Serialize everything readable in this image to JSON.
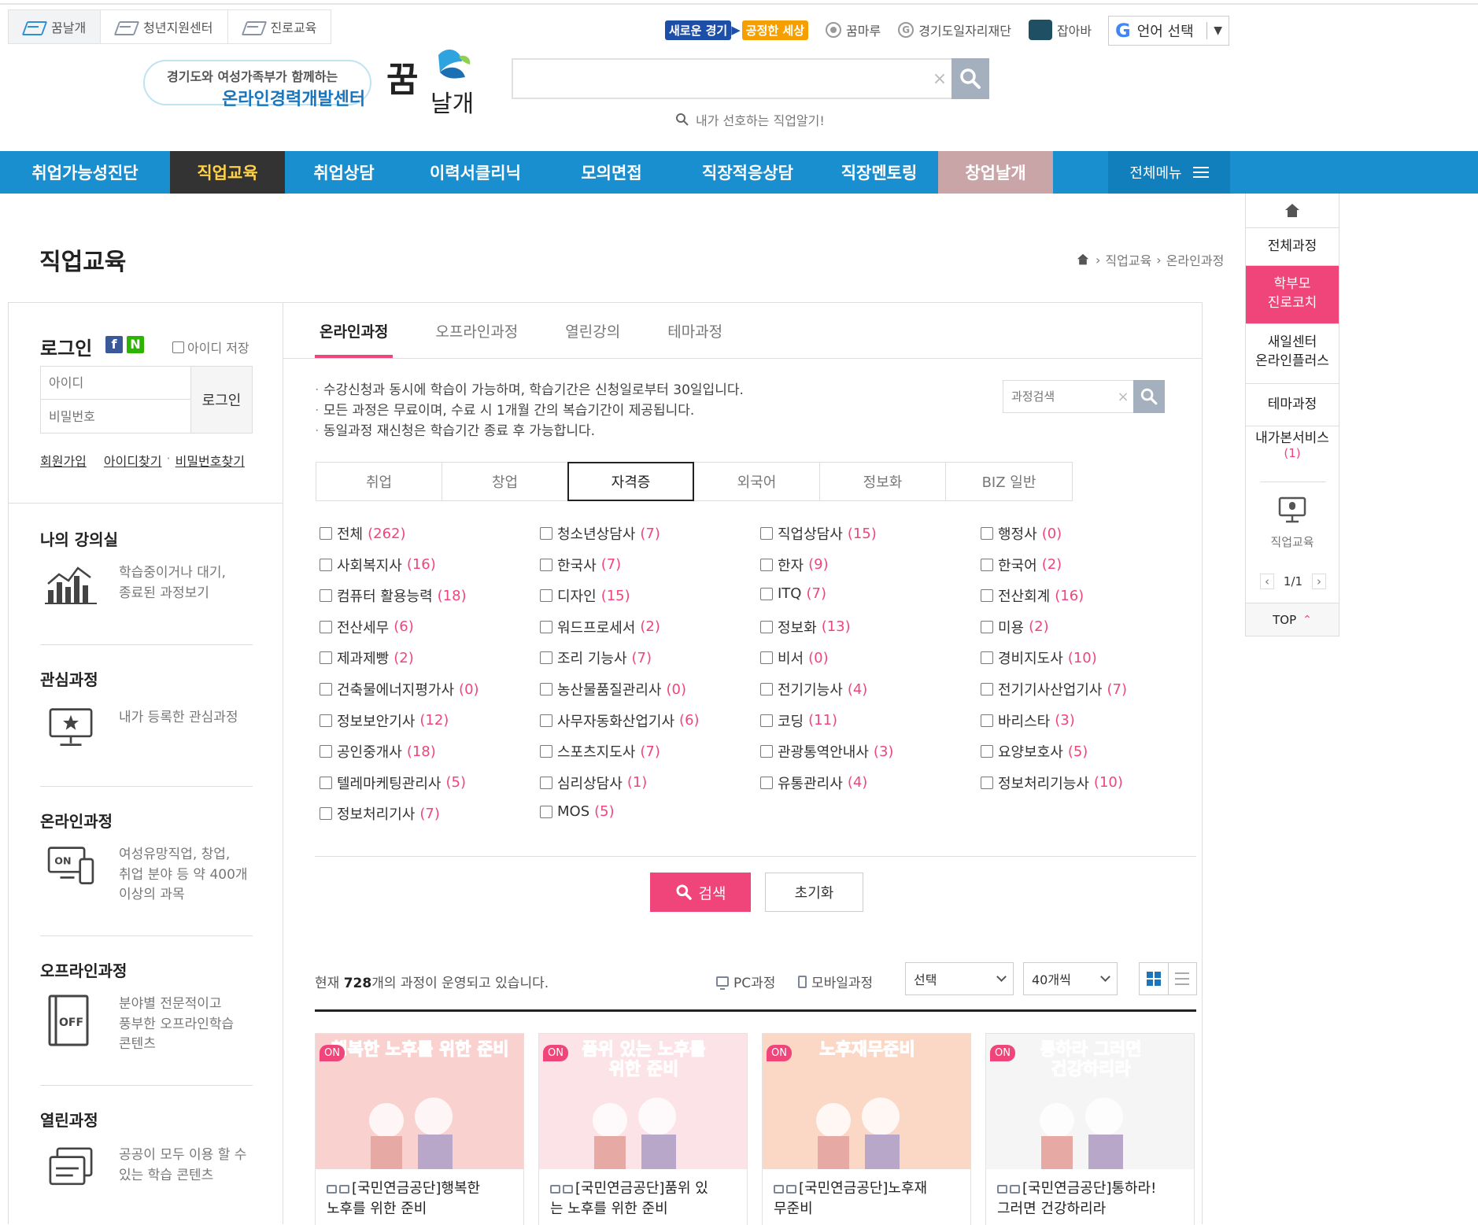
{
  "util_tabs": [
    "꿈날개",
    "청년지원센터",
    "진로교육"
  ],
  "partners": {
    "badge_1": "새로운 경기",
    "badge_2": "공정한 세상",
    "items": [
      "꿈마루",
      "경기도일자리재단",
      "잡아바"
    ]
  },
  "language": {
    "label": "언어 선택"
  },
  "logo": {
    "line1": "경기도와 여성가족부가 함께하는",
    "line2": "온라인경력개발센터",
    "mark_1": "꿈",
    "mark_2": "날개"
  },
  "search": {
    "placeholder": "",
    "hint": "내가 선호하는 직업알기!"
  },
  "gnb": {
    "items": [
      "취업가능성진단",
      "직업교육",
      "취업상담",
      "이력서클리닉",
      "모의면접",
      "직장적응상담",
      "직장멘토링",
      "창업날개"
    ],
    "all_menu": "전체메뉴"
  },
  "quick": {
    "all_courses": "전체과정",
    "parent_coach_1": "학부모",
    "parent_coach_2": "진로코치",
    "saeil_1": "새일센터",
    "saeil_2": "온라인플러스",
    "theme": "테마과정",
    "my_service": "내가본서비스",
    "my_service_count": "(1)",
    "recent_label": "직업교육",
    "pager": "1/1",
    "top": "TOP"
  },
  "page": {
    "title": "직업교육",
    "breadcrumb": [
      "직업교육",
      "온라인과정"
    ]
  },
  "login": {
    "title": "로그인",
    "facebook": "f",
    "naver": "N",
    "save_id": "아이디 저장",
    "id_placeholder": "아이디",
    "pw_placeholder": "비밀번호",
    "button": "로그인",
    "join": "회원가입",
    "find_id": "아이디찾기",
    "dot": "·",
    "find_pw": "비밀번호찾기"
  },
  "side": [
    {
      "title": "나의 강의실",
      "desc_1": "학습중이거나 대기,",
      "desc_2": "종료된 과정보기",
      "desc_3": ""
    },
    {
      "title": "관심과정",
      "desc_1": "내가 등록한 관심과정",
      "desc_2": "",
      "desc_3": ""
    },
    {
      "title": "온라인과정",
      "desc_1": "여성유망직업, 창업,",
      "desc_2": "취업 분야 등 약 400개",
      "desc_3": "이상의 과목"
    },
    {
      "title": "오프라인과정",
      "desc_1": "분야별 전문적이고",
      "desc_2": "풍부한 오프라인학습",
      "desc_3": "콘텐츠"
    },
    {
      "title": "열린과정",
      "desc_1": "공공이 모두 이용 할 수",
      "desc_2": "있는 학습 콘텐츠",
      "desc_3": ""
    }
  ],
  "side_icons": {
    "on": "ON",
    "off": "OFF"
  },
  "tabs": [
    "온라인과정",
    "오프라인과정",
    "열린강의",
    "테마과정"
  ],
  "notice": [
    "수강신청과 동시에 학습이 가능하며, 학습기간은 신청일로부터 30일입니다.",
    "모든 과정은 무료이며, 수료 시 1개월 간의 복습기간이 제공됩니다.",
    "동일과정 재신청은 학습기간 종료 후 가능합니다."
  ],
  "course_search": {
    "placeholder": "과정검색"
  },
  "categories": [
    "취업",
    "창업",
    "자격증",
    "외국어",
    "정보화",
    "BIZ 일반"
  ],
  "checkboxes": [
    [
      "전체",
      "(262)"
    ],
    [
      "청소년상담사",
      "(7)"
    ],
    [
      "직업상담사",
      "(15)"
    ],
    [
      "행정사",
      "(0)"
    ],
    [
      "사회복지사",
      "(16)"
    ],
    [
      "한국사",
      "(7)"
    ],
    [
      "한자",
      "(9)"
    ],
    [
      "한국어",
      "(2)"
    ],
    [
      "컴퓨터 활용능력",
      "(18)"
    ],
    [
      "디자인",
      "(15)"
    ],
    [
      "ITQ",
      "(7)"
    ],
    [
      "전산회계",
      "(16)"
    ],
    [
      "전산세무",
      "(6)"
    ],
    [
      "워드프로세서",
      "(2)"
    ],
    [
      "정보화",
      "(13)"
    ],
    [
      "미용",
      "(2)"
    ],
    [
      "제과제빵",
      "(2)"
    ],
    [
      "조리 기능사",
      "(7)"
    ],
    [
      "비서",
      "(0)"
    ],
    [
      "경비지도사",
      "(10)"
    ],
    [
      "건축물에너지평가사",
      "(0)"
    ],
    [
      "농산물품질관리사",
      "(0)"
    ],
    [
      "전기기능사",
      "(4)"
    ],
    [
      "전기기사산업기사",
      "(7)"
    ],
    [
      "정보보안기사",
      "(12)"
    ],
    [
      "사무자동화산업기사",
      "(6)"
    ],
    [
      "코딩",
      "(11)"
    ],
    [
      "바리스타",
      "(3)"
    ],
    [
      "공인중개사",
      "(18)"
    ],
    [
      "스포츠지도사",
      "(7)"
    ],
    [
      "관광통역안내사",
      "(3)"
    ],
    [
      "요양보호사",
      "(5)"
    ],
    [
      "텔레마케팅관리사",
      "(5)"
    ],
    [
      "심리상담사",
      "(1)"
    ],
    [
      "유통관리사",
      "(4)"
    ],
    [
      "정보처리기능사",
      "(10)"
    ],
    [
      "정보처리기사",
      "(7)"
    ],
    [
      "MOS",
      "(5)"
    ]
  ],
  "buttons": {
    "search": "검색",
    "reset": "초기화"
  },
  "list": {
    "count_prefix": "현재",
    "count": "728",
    "count_suffix": "개의 과정이 운영되고 있습니다.",
    "pc": "PC과정",
    "mobile": "모바일과정",
    "select": "선택",
    "per_page": "40개씩"
  },
  "courses": [
    {
      "badge": "ON",
      "thumb_title_1": "행복한 노후를 위한 준비",
      "thumb_title_2": "",
      "name_1": "[국민연금공단]행복한",
      "name_2": "노후를 위한 준비",
      "bg": "#f9d2cf"
    },
    {
      "badge": "ON",
      "thumb_title_1": "품위 있는 노후를",
      "thumb_title_2": "위한 준비",
      "name_1": "[국민연금공단]품위 있",
      "name_2": "는 노후를 위한 준비",
      "bg": "#fbe3e8"
    },
    {
      "badge": "ON",
      "thumb_title_1": "노후재무준비",
      "thumb_title_2": "",
      "name_1": "[국민연금공단]노후재",
      "name_2": "무준비",
      "bg": "#fbd8c6"
    },
    {
      "badge": "ON",
      "thumb_title_1": "통하라 그러면",
      "thumb_title_2": "건강하리라",
      "name_1": "[국민연금공단]통하라!",
      "name_2": "그러면 건강하리라",
      "bg": "#f5f5f5"
    }
  ],
  "colors": {
    "accent_pink": "#f0457b",
    "nav_blue": "#1a8fd0",
    "nav_active": "#333333",
    "nav_active_text": "#ffd24a"
  }
}
